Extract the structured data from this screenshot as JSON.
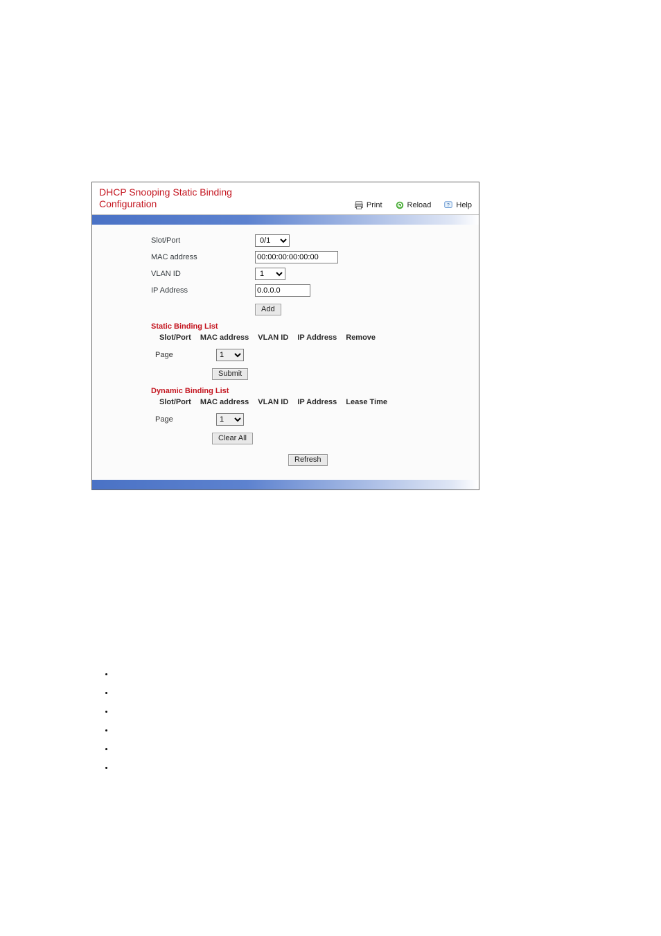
{
  "header": {
    "title": "DHCP Snooping Static Binding Configuration",
    "print": "Print",
    "reload": "Reload",
    "help": "Help"
  },
  "form": {
    "slot_port_label": "Slot/Port",
    "slot_port_value": "0/1",
    "mac_label": "MAC address",
    "mac_value": "00:00:00:00:00:00",
    "vlan_label": "VLAN ID",
    "vlan_value": "1",
    "ip_label": "IP Address",
    "ip_value": "0.0.0.0",
    "add_label": "Add"
  },
  "static_list": {
    "title": "Static Binding List",
    "headers": {
      "slot_port": "Slot/Port",
      "mac": "MAC address",
      "vlan": "VLAN ID",
      "ip": "IP Address",
      "remove": "Remove"
    },
    "page_label": "Page",
    "page_value": "1",
    "submit_label": "Submit"
  },
  "dynamic_list": {
    "title": "Dynamic Binding List",
    "headers": {
      "slot_port": "Slot/Port",
      "mac": "MAC address",
      "vlan": "VLAN ID",
      "ip": "IP Address",
      "lease": "Lease Time"
    },
    "page_label": "Page",
    "page_value": "1",
    "clear_label": "Clear All"
  },
  "refresh_label": "Refresh"
}
